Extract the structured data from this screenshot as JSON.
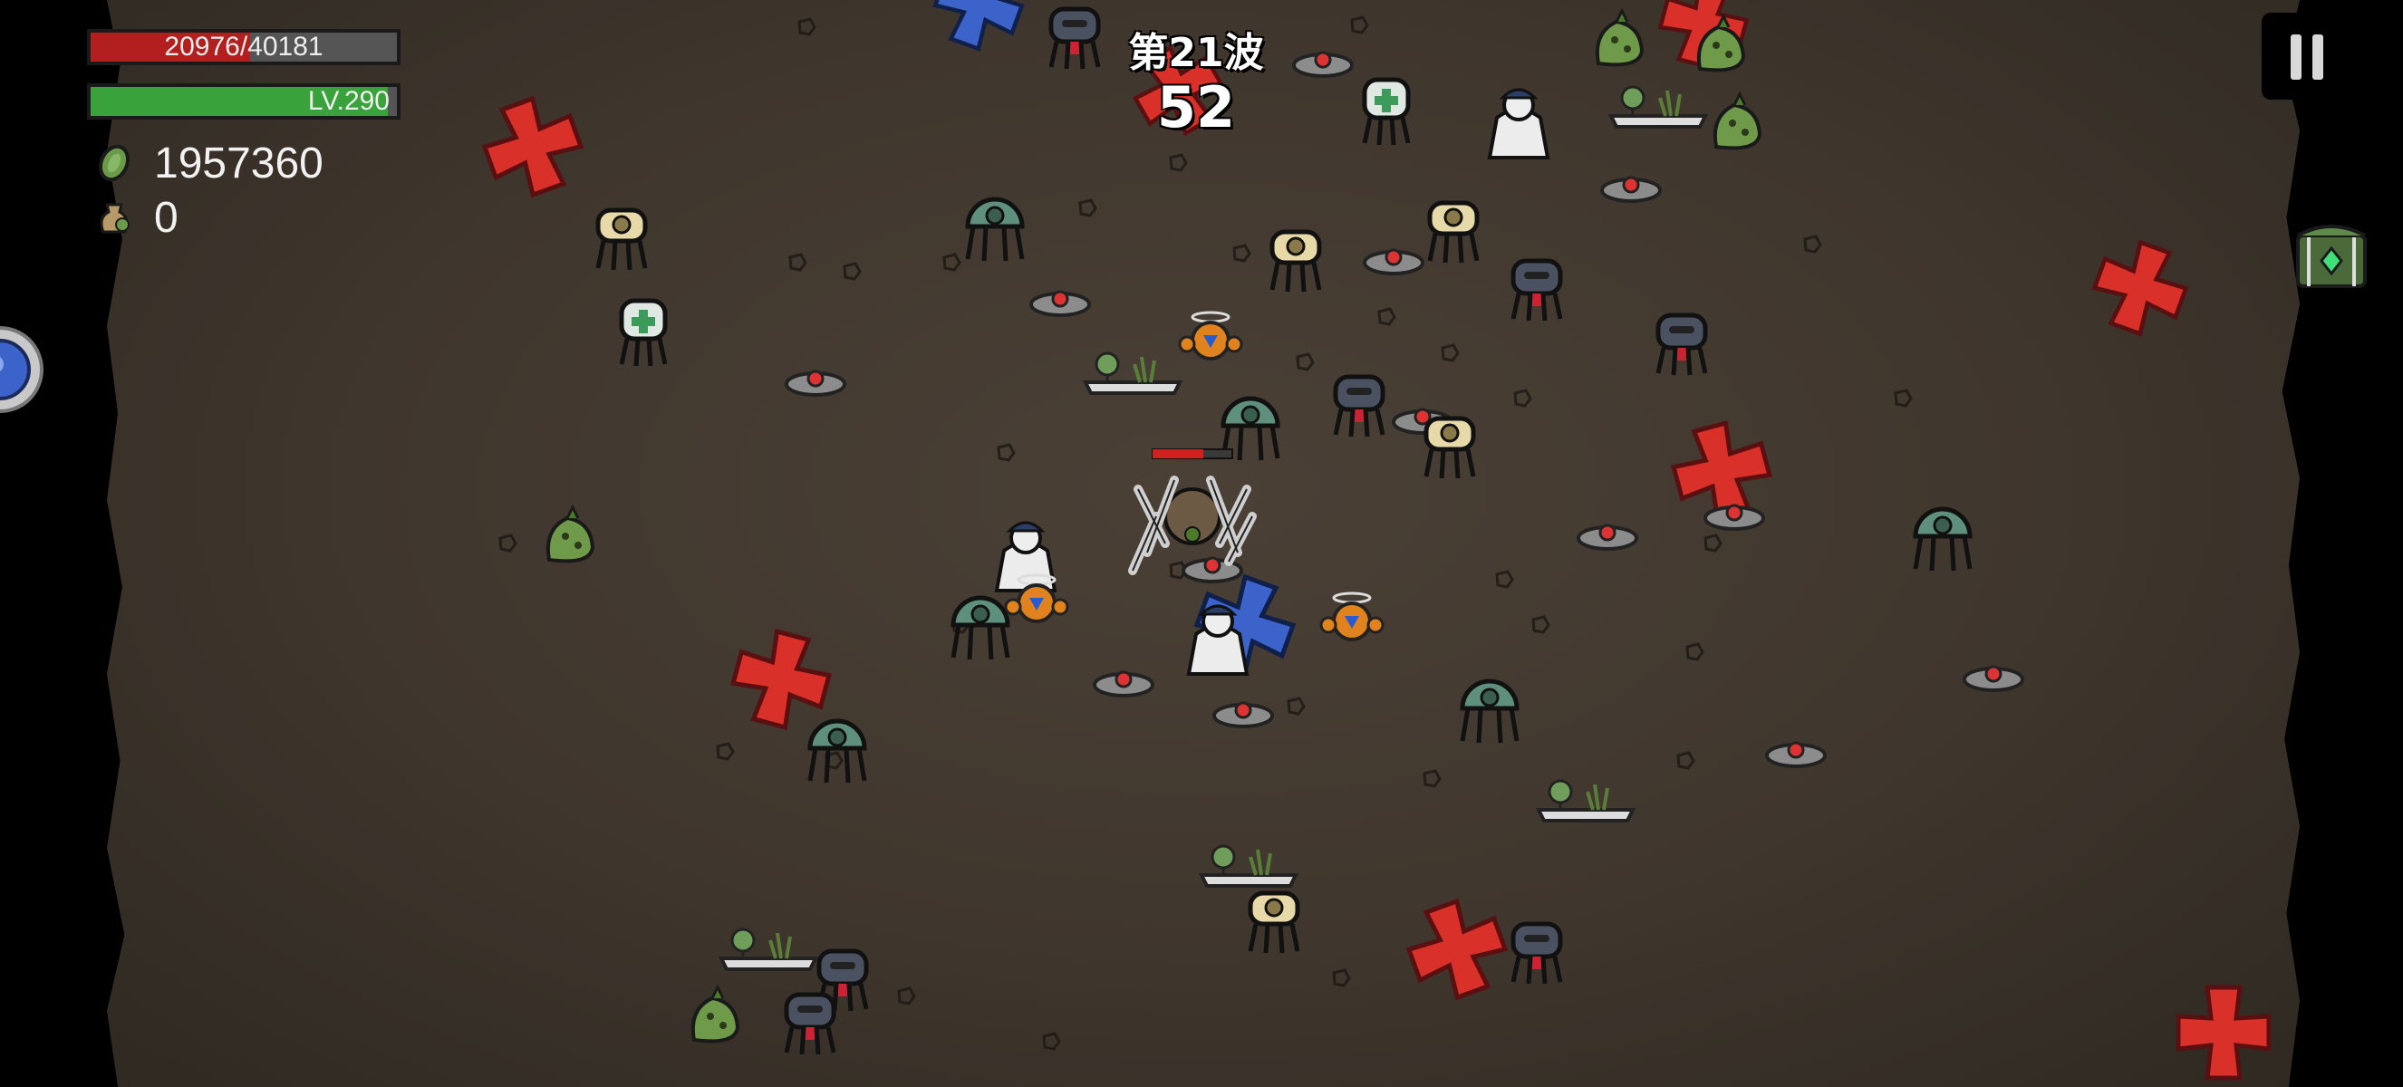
{
  "hud": {
    "hp": {
      "text": "20976/40181",
      "current": 20976,
      "max": 40181,
      "color": "#b21f1f"
    },
    "level": {
      "text": "LV.290",
      "progress": 0.97,
      "color": "#3aa23a"
    },
    "coins": {
      "value": "1957360",
      "icon": "green-coin-icon"
    },
    "bags": {
      "value": "0",
      "icon": "money-bag-icon"
    }
  },
  "wave": {
    "title": "第21波",
    "countdown": "52"
  },
  "controls": {
    "pause_icon": "pause-icon",
    "chest_icon": "chest-icon",
    "skill_icon": "skill-orb-icon"
  },
  "colors": {
    "ground": "#4a4036",
    "red_marker": "#d9302a",
    "blue_marker": "#3b63c9"
  }
}
